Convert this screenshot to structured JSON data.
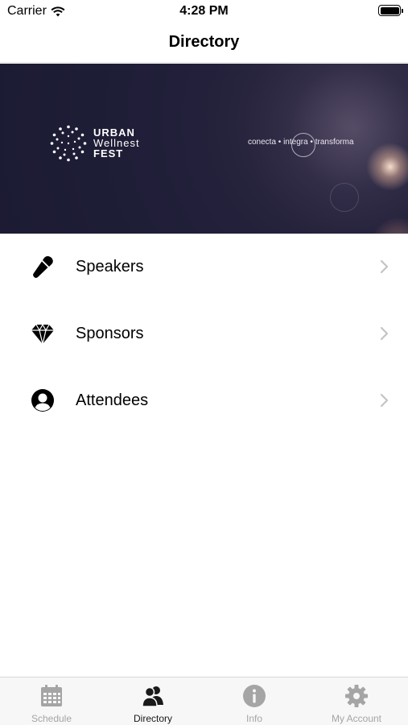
{
  "status_bar": {
    "carrier": "Carrier",
    "time": "4:28 PM"
  },
  "nav": {
    "title": "Directory"
  },
  "banner": {
    "logo_line1": "URBAN",
    "logo_line2": "Wellnest",
    "logo_line3": "FEST",
    "tagline": "conecta • integra • transforma"
  },
  "list": {
    "items": [
      {
        "label": "Speakers",
        "icon": "microphone-icon"
      },
      {
        "label": "Sponsors",
        "icon": "diamond-icon"
      },
      {
        "label": "Attendees",
        "icon": "person-icon"
      }
    ]
  },
  "tabs": [
    {
      "label": "Schedule",
      "icon": "calendar-icon",
      "active": false
    },
    {
      "label": "Directory",
      "icon": "people-icon",
      "active": true
    },
    {
      "label": "Info",
      "icon": "info-icon",
      "active": false
    },
    {
      "label": "My Account",
      "icon": "gear-icon",
      "active": false
    }
  ],
  "colors": {
    "active_tab": "#1a1a1a",
    "inactive_tab": "#a5a5a5",
    "banner_bg": "#1e1d36"
  }
}
